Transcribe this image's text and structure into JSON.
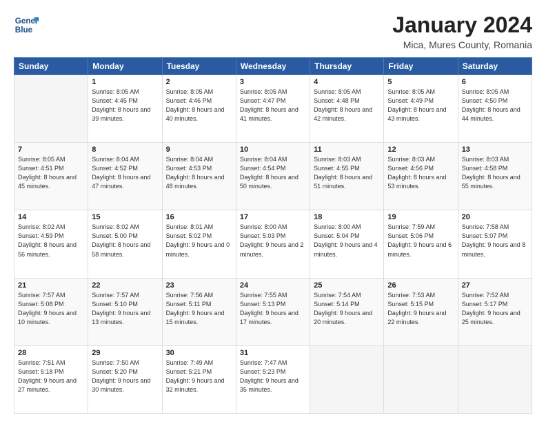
{
  "header": {
    "logo_line1": "General",
    "logo_line2": "Blue",
    "title": "January 2024",
    "subtitle": "Mica, Mures County, Romania"
  },
  "calendar": {
    "days_of_week": [
      "Sunday",
      "Monday",
      "Tuesday",
      "Wednesday",
      "Thursday",
      "Friday",
      "Saturday"
    ],
    "weeks": [
      [
        {
          "day": "",
          "sunrise": "",
          "sunset": "",
          "daylight": ""
        },
        {
          "day": "1",
          "sunrise": "Sunrise: 8:05 AM",
          "sunset": "Sunset: 4:45 PM",
          "daylight": "Daylight: 8 hours and 39 minutes."
        },
        {
          "day": "2",
          "sunrise": "Sunrise: 8:05 AM",
          "sunset": "Sunset: 4:46 PM",
          "daylight": "Daylight: 8 hours and 40 minutes."
        },
        {
          "day": "3",
          "sunrise": "Sunrise: 8:05 AM",
          "sunset": "Sunset: 4:47 PM",
          "daylight": "Daylight: 8 hours and 41 minutes."
        },
        {
          "day": "4",
          "sunrise": "Sunrise: 8:05 AM",
          "sunset": "Sunset: 4:48 PM",
          "daylight": "Daylight: 8 hours and 42 minutes."
        },
        {
          "day": "5",
          "sunrise": "Sunrise: 8:05 AM",
          "sunset": "Sunset: 4:49 PM",
          "daylight": "Daylight: 8 hours and 43 minutes."
        },
        {
          "day": "6",
          "sunrise": "Sunrise: 8:05 AM",
          "sunset": "Sunset: 4:50 PM",
          "daylight": "Daylight: 8 hours and 44 minutes."
        }
      ],
      [
        {
          "day": "7",
          "sunrise": "Sunrise: 8:05 AM",
          "sunset": "Sunset: 4:51 PM",
          "daylight": "Daylight: 8 hours and 45 minutes."
        },
        {
          "day": "8",
          "sunrise": "Sunrise: 8:04 AM",
          "sunset": "Sunset: 4:52 PM",
          "daylight": "Daylight: 8 hours and 47 minutes."
        },
        {
          "day": "9",
          "sunrise": "Sunrise: 8:04 AM",
          "sunset": "Sunset: 4:53 PM",
          "daylight": "Daylight: 8 hours and 48 minutes."
        },
        {
          "day": "10",
          "sunrise": "Sunrise: 8:04 AM",
          "sunset": "Sunset: 4:54 PM",
          "daylight": "Daylight: 8 hours and 50 minutes."
        },
        {
          "day": "11",
          "sunrise": "Sunrise: 8:03 AM",
          "sunset": "Sunset: 4:55 PM",
          "daylight": "Daylight: 8 hours and 51 minutes."
        },
        {
          "day": "12",
          "sunrise": "Sunrise: 8:03 AM",
          "sunset": "Sunset: 4:56 PM",
          "daylight": "Daylight: 8 hours and 53 minutes."
        },
        {
          "day": "13",
          "sunrise": "Sunrise: 8:03 AM",
          "sunset": "Sunset: 4:58 PM",
          "daylight": "Daylight: 8 hours and 55 minutes."
        }
      ],
      [
        {
          "day": "14",
          "sunrise": "Sunrise: 8:02 AM",
          "sunset": "Sunset: 4:59 PM",
          "daylight": "Daylight: 8 hours and 56 minutes."
        },
        {
          "day": "15",
          "sunrise": "Sunrise: 8:02 AM",
          "sunset": "Sunset: 5:00 PM",
          "daylight": "Daylight: 8 hours and 58 minutes."
        },
        {
          "day": "16",
          "sunrise": "Sunrise: 8:01 AM",
          "sunset": "Sunset: 5:02 PM",
          "daylight": "Daylight: 9 hours and 0 minutes."
        },
        {
          "day": "17",
          "sunrise": "Sunrise: 8:00 AM",
          "sunset": "Sunset: 5:03 PM",
          "daylight": "Daylight: 9 hours and 2 minutes."
        },
        {
          "day": "18",
          "sunrise": "Sunrise: 8:00 AM",
          "sunset": "Sunset: 5:04 PM",
          "daylight": "Daylight: 9 hours and 4 minutes."
        },
        {
          "day": "19",
          "sunrise": "Sunrise: 7:59 AM",
          "sunset": "Sunset: 5:06 PM",
          "daylight": "Daylight: 9 hours and 6 minutes."
        },
        {
          "day": "20",
          "sunrise": "Sunrise: 7:58 AM",
          "sunset": "Sunset: 5:07 PM",
          "daylight": "Daylight: 9 hours and 8 minutes."
        }
      ],
      [
        {
          "day": "21",
          "sunrise": "Sunrise: 7:57 AM",
          "sunset": "Sunset: 5:08 PM",
          "daylight": "Daylight: 9 hours and 10 minutes."
        },
        {
          "day": "22",
          "sunrise": "Sunrise: 7:57 AM",
          "sunset": "Sunset: 5:10 PM",
          "daylight": "Daylight: 9 hours and 13 minutes."
        },
        {
          "day": "23",
          "sunrise": "Sunrise: 7:56 AM",
          "sunset": "Sunset: 5:11 PM",
          "daylight": "Daylight: 9 hours and 15 minutes."
        },
        {
          "day": "24",
          "sunrise": "Sunrise: 7:55 AM",
          "sunset": "Sunset: 5:13 PM",
          "daylight": "Daylight: 9 hours and 17 minutes."
        },
        {
          "day": "25",
          "sunrise": "Sunrise: 7:54 AM",
          "sunset": "Sunset: 5:14 PM",
          "daylight": "Daylight: 9 hours and 20 minutes."
        },
        {
          "day": "26",
          "sunrise": "Sunrise: 7:53 AM",
          "sunset": "Sunset: 5:15 PM",
          "daylight": "Daylight: 9 hours and 22 minutes."
        },
        {
          "day": "27",
          "sunrise": "Sunrise: 7:52 AM",
          "sunset": "Sunset: 5:17 PM",
          "daylight": "Daylight: 9 hours and 25 minutes."
        }
      ],
      [
        {
          "day": "28",
          "sunrise": "Sunrise: 7:51 AM",
          "sunset": "Sunset: 5:18 PM",
          "daylight": "Daylight: 9 hours and 27 minutes."
        },
        {
          "day": "29",
          "sunrise": "Sunrise: 7:50 AM",
          "sunset": "Sunset: 5:20 PM",
          "daylight": "Daylight: 9 hours and 30 minutes."
        },
        {
          "day": "30",
          "sunrise": "Sunrise: 7:49 AM",
          "sunset": "Sunset: 5:21 PM",
          "daylight": "Daylight: 9 hours and 32 minutes."
        },
        {
          "day": "31",
          "sunrise": "Sunrise: 7:47 AM",
          "sunset": "Sunset: 5:23 PM",
          "daylight": "Daylight: 9 hours and 35 minutes."
        },
        {
          "day": "",
          "sunrise": "",
          "sunset": "",
          "daylight": ""
        },
        {
          "day": "",
          "sunrise": "",
          "sunset": "",
          "daylight": ""
        },
        {
          "day": "",
          "sunrise": "",
          "sunset": "",
          "daylight": ""
        }
      ]
    ]
  }
}
